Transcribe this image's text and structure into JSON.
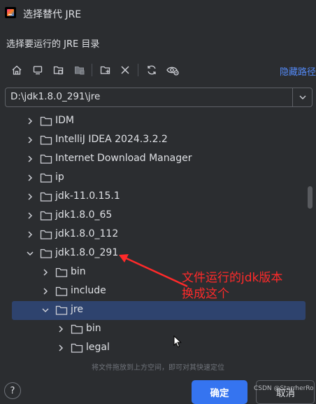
{
  "window": {
    "title": "选择替代 JRE"
  },
  "dialog": {
    "subtitle": "选择要运行的 JRE 目录"
  },
  "toolbar": {
    "hide_path_label": "隐藏路径",
    "buttons": [
      "home-icon",
      "desktop-icon",
      "project-icon",
      "module-icon",
      "new-folder-icon",
      "delete-icon",
      "refresh-icon",
      "show-hidden-icon"
    ]
  },
  "path": {
    "value": "D:\\jdk1.8.0_291\\jre"
  },
  "tree": {
    "rows": [
      {
        "label": "IDM",
        "expanded": false
      },
      {
        "label": "IntelliJ IDEA 2024.3.2.2",
        "expanded": false
      },
      {
        "label": "Internet Download Manager",
        "expanded": false
      },
      {
        "label": "ip",
        "expanded": false
      },
      {
        "label": "jdk-11.0.15.1",
        "expanded": false
      },
      {
        "label": "jdk1.8.0_65",
        "expanded": false
      },
      {
        "label": "jdk1.8.0_112",
        "expanded": false
      },
      {
        "label": "jdk1.8.0_291",
        "expanded": true
      },
      {
        "label": "bin",
        "expanded": false
      },
      {
        "label": "include",
        "expanded": false
      },
      {
        "label": "jre",
        "expanded": true,
        "selected": true
      },
      {
        "label": "bin",
        "expanded": false
      },
      {
        "label": "legal",
        "expanded": false
      }
    ]
  },
  "hint": "将文件拖放到上方空间，即可对其快速定位",
  "footer": {
    "help": "?",
    "ok_label": "确定",
    "cancel_label": "取消"
  },
  "annotation": {
    "line1": "文件运行的jdk版本",
    "line2": "换成这个",
    "color": "#ff2a2a"
  },
  "watermark": "CSDN @StarrherRo",
  "colors": {
    "background": "#2b2d30",
    "selection": "#2e436e",
    "primary_button": "#3574f0",
    "link": "#548af7"
  }
}
